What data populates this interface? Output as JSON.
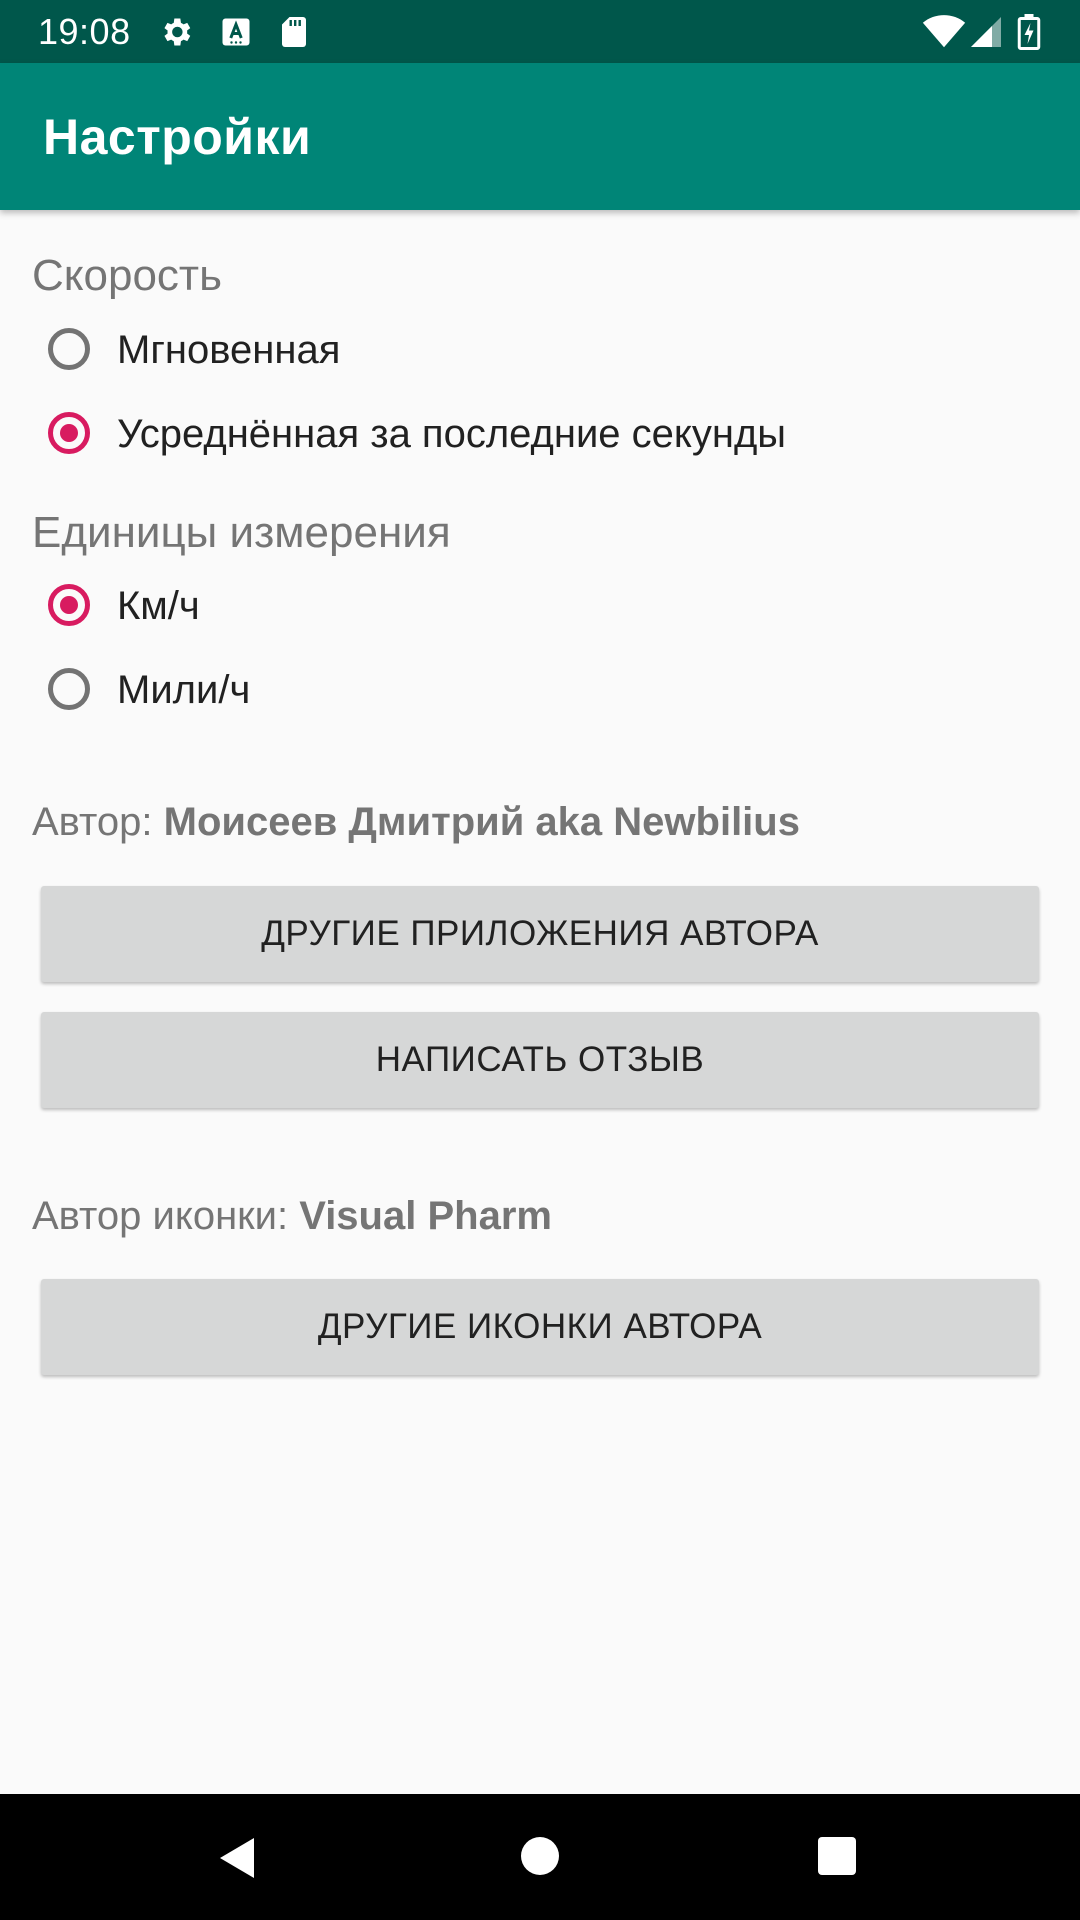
{
  "status_bar": {
    "time": "19:08",
    "icons_left": [
      "settings-icon",
      "keyboard-a-icon",
      "sd-card-icon"
    ],
    "icons_right": [
      "wifi-icon",
      "cell-signal-icon",
      "battery-charging-icon"
    ]
  },
  "app_bar": {
    "title": "Настройки",
    "color": "#008577",
    "status_color": "#00574b"
  },
  "speed": {
    "title": "Скорость",
    "options": [
      {
        "label": "Мгновенная",
        "checked": false
      },
      {
        "label": "Усреднённая за последние секунды",
        "checked": true
      }
    ]
  },
  "units": {
    "title": "Единицы измерения",
    "options": [
      {
        "label": "Км/ч",
        "checked": true
      },
      {
        "label": "Мили/ч",
        "checked": false
      }
    ]
  },
  "author": {
    "prefix": "Автор: ",
    "name": "Моисеев Дмитрий aka Newbilius"
  },
  "buttons": {
    "other_apps": "ДРУГИЕ ПРИЛОЖЕНИЯ АВТОРА",
    "write_review": "НАПИСАТЬ ОТЗЫВ",
    "other_icons": "ДРУГИЕ ИКОНКИ АВТОРА"
  },
  "icon_author": {
    "prefix": "Автор иконки: ",
    "name": "Visual Pharm"
  },
  "accent_color": "#d81b60",
  "nav_bar": {
    "icons": [
      "back-icon",
      "home-icon",
      "recents-icon"
    ]
  }
}
